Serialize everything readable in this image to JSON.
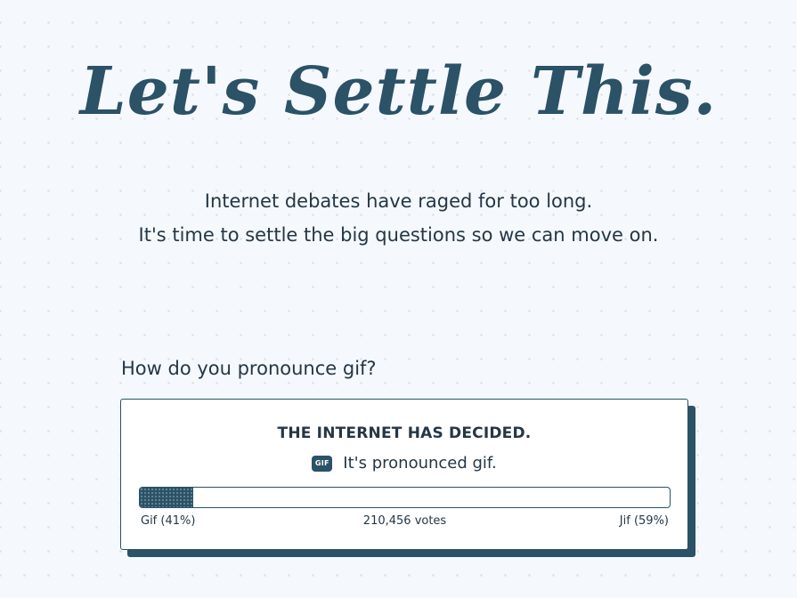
{
  "hero": {
    "title": "Let's Settle This."
  },
  "intro": {
    "line1": "Internet debates have raged for too long.",
    "line2": "It's time to settle the big questions so we can move on."
  },
  "poll": {
    "question": "How do you pronounce gif?",
    "verdict_heading": "THE INTERNET HAS DECIDED.",
    "badge_label": "GIF",
    "answer": "It's pronounced gif.",
    "progress_fraction": 0.1,
    "left_label": "Gif (41%)",
    "votes_label": "210,456 votes",
    "right_label": "Jif (59%)"
  },
  "colors": {
    "background": "#f5f8fc",
    "accent": "#2b5266",
    "text": "#243746"
  }
}
